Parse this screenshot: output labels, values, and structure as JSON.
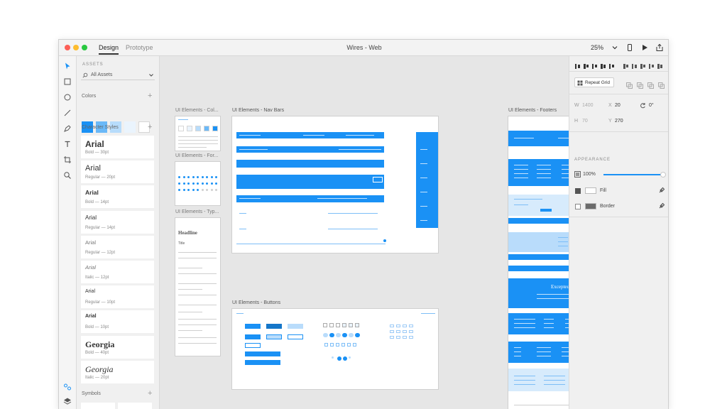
{
  "window": {
    "title": "Wires - Web",
    "tabs": [
      {
        "label": "Design"
      },
      {
        "label": "Prototype"
      }
    ],
    "zoom": "25%"
  },
  "colors": {
    "accent": "#1a91f5",
    "traffic_red": "#fd5f57",
    "traffic_yellow": "#fdbc2e",
    "traffic_green": "#29c840"
  },
  "assets": {
    "header": "ASSETS",
    "filter": "All Assets",
    "colors_label": "Colors",
    "swatches": [
      "#1a91f5",
      "#6bb9f8",
      "#b7dcfb",
      "#eaf4fd",
      "#ffffff"
    ],
    "character_styles_label": "Character Styles",
    "character_styles": [
      {
        "name": "Arial",
        "desc": "Bold — 30pt"
      },
      {
        "name": "Arial",
        "desc": "Regular — 20pt"
      },
      {
        "name": "Arial",
        "desc": "Bold — 14pt"
      },
      {
        "name": "Arial",
        "desc": "Regular — 14pt"
      },
      {
        "name": "Arial",
        "desc": "Regular — 12pt"
      },
      {
        "name": "Arial",
        "desc": "Italic — 12pt"
      },
      {
        "name": "Arial",
        "desc": "Regular — 10pt"
      },
      {
        "name": "Arial",
        "desc": "Bold — 10pt"
      },
      {
        "name": "Georgia",
        "desc": "Bold — 40pt"
      },
      {
        "name": "Georgia",
        "desc": "Italic — 20pt"
      }
    ],
    "symbols_label": "Symbols"
  },
  "canvas": {
    "artboards": {
      "colors": "UI Elements - Col...",
      "forms": "UI Elements - For...",
      "type": "UI Elements - Typ...",
      "navbars": "UI Elements - Nav Bars",
      "buttons": "UI Elements - Buttons",
      "footers": "UI Elements - Footers"
    },
    "type_sample": {
      "headline": "Headline",
      "title": "Title"
    },
    "footer_sample": {
      "headline": "Excepteur occaecat cupidatat."
    }
  },
  "properties": {
    "repeat_grid": "Repeat Grid",
    "w_label": "W",
    "w_value": "1400",
    "h_label": "H",
    "h_value": "70",
    "x_label": "X",
    "x_value": "20",
    "y_label": "Y",
    "y_value": "270",
    "rotation": "0°",
    "appearance_label": "APPEARANCE",
    "opacity": "100%",
    "fill_label": "Fill",
    "border_label": "Border"
  }
}
